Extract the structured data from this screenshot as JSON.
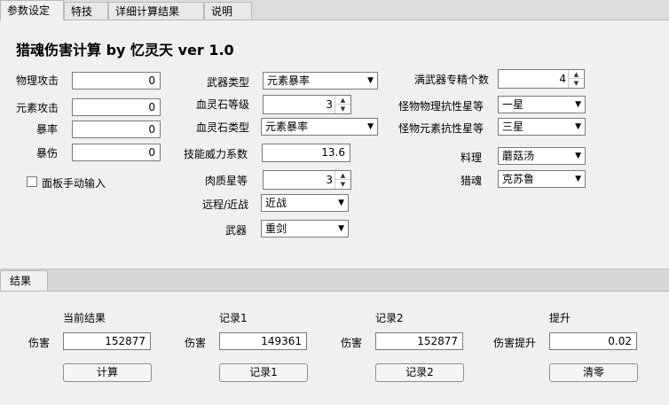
{
  "tabs": [
    "参数设定",
    "特技",
    "详细计算结果",
    "说明"
  ],
  "title": "猎魂伤害计算 by 忆灵天 ver 1.0",
  "left": {
    "phys_atk_label": "物理攻击",
    "phys_atk": "0",
    "elem_atk_label": "元素攻击",
    "elem_atk": "0",
    "crit_label": "暴率",
    "crit": "0",
    "critdmg_label": "暴伤",
    "critdmg": "0",
    "manual_label": "面板手动输入"
  },
  "mid": {
    "weapon_type_label": "武器类型",
    "weapon_type": "元素暴率",
    "bloodstone_level_label": "血灵石等级",
    "bloodstone_level": "3",
    "bloodstone_type_label": "血灵石类型",
    "bloodstone_type": "元素暴率",
    "skill_coef_label": "技能威力系数",
    "skill_coef": "13.6",
    "meat_label": "肉质星等",
    "meat": "3",
    "range_label": "远程/近战",
    "range": "近战",
    "weapon_label": "武器",
    "weapon": "重剑"
  },
  "right": {
    "full_weapon_label": "满武器专精个数",
    "full_weapon": "4",
    "phys_res_label": "怪物物理抗性星等",
    "phys_res": "一星",
    "elem_res_label": "怪物元素抗性星等",
    "elem_res": "三星",
    "food_label": "料理",
    "food": "蘑菇汤",
    "soul_label": "猎魂",
    "soul": "克苏鲁"
  },
  "results_tab": "结果",
  "results": {
    "current_header": "当前结果",
    "current_label": "伤害",
    "current": "152877",
    "calc_btn": "计算",
    "rec1_header": "记录1",
    "rec1_label": "伤害",
    "rec1": "149361",
    "rec1_btn": "记录1",
    "rec2_header": "记录2",
    "rec2_label": "伤害",
    "rec2": "152877",
    "rec2_btn": "记录2",
    "gain_header": "提升",
    "gain_label": "伤害提升",
    "gain": "0.02",
    "clear_btn": "清零"
  }
}
